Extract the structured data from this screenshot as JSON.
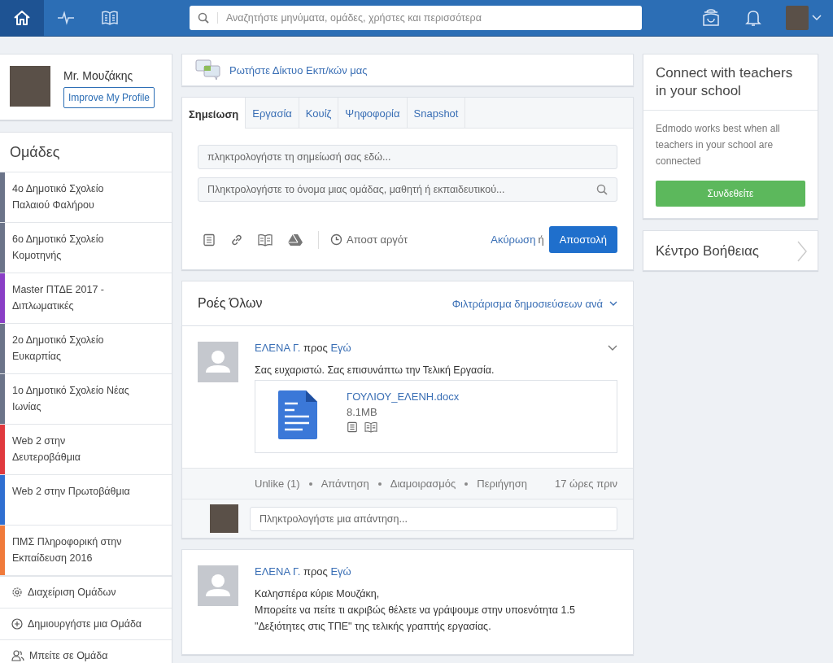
{
  "nav": [
    {
      "kind": "home",
      "selected": true
    },
    {
      "kind": "pulse",
      "selected": false
    },
    {
      "kind": "book",
      "selected": false
    }
  ],
  "search": {
    "placeholder": "Αναζητήστε μηνύματα, ομάδες, χρήστες και περισσότερα"
  },
  "profile": {
    "name": "Mr. Μουζάκης",
    "button": "Improve My Profile"
  },
  "groups": {
    "title": "Ομάδες",
    "items": [
      {
        "name": "4ο Δημοτικό Σχολείο Παλαιού Φαλήρου",
        "color": "#6b7489"
      },
      {
        "name": "6ο Δημοτικό Σχολείο Κομοτηνής",
        "color": "#6b7489"
      },
      {
        "name": "Master ΠΤΔΕ 2017 - Διπλωματικές",
        "color": "#8a3fc6"
      },
      {
        "name": "2ο Δημοτικό Σχολείο Ευκαρπίας",
        "color": "#6b7489"
      },
      {
        "name": "1ο Δημοτικό Σχολείο Νέας Ιωνίας",
        "color": "#6b7489"
      },
      {
        "name": "Web 2 στην Δευτεροβάθμια",
        "color": "#e0393e"
      },
      {
        "name": "Web 2 στην Πρωτοβάθμια",
        "color": "#2f6fd1"
      },
      {
        "name": "ΠΜΣ Πληροφορική στην Εκπαίδευση 2016",
        "color": "#f07a3a"
      }
    ],
    "actions": [
      {
        "kind": "gear",
        "label": "Διαχείριση Ομάδων"
      },
      {
        "kind": "plus",
        "label": "Δημιουργήστε μια Ομάδα"
      },
      {
        "kind": "join",
        "label": "Μπείτε σε Ομάδα"
      }
    ]
  },
  "ask": {
    "label": "Ρωτήστε Δίκτυο Εκπ/κών μας"
  },
  "composer": {
    "tabs": [
      {
        "label": "Σημείωση",
        "selected": true
      },
      {
        "label": "Εργασία",
        "selected": false
      },
      {
        "label": "Κουίζ",
        "selected": false
      },
      {
        "label": "Ψηφοφορία",
        "selected": false
      },
      {
        "label": "Snapshot",
        "selected": false
      }
    ],
    "note_placeholder": "πληκτρολογήστε τη σημείωσή σας εδώ...",
    "recipient_placeholder": "Πληκτρολογήστε το όνομα μιας ομάδας, μαθητή ή εκπαιδευτικού...",
    "schedule": "Αποστ αργότ",
    "cancel": "Ακύρωση",
    "or": "ή",
    "send": "Αποστολή"
  },
  "feed": {
    "title": "Ροές Όλων",
    "filter": "Φιλτράρισμα δημοσιεύσεων ανά",
    "posts": [
      {
        "author": "ΕΛΕΝΑ Γ.",
        "to": "προς",
        "recipient": "Εγώ",
        "body": [
          "Σας ευχαριστώ. Σας επισυνάπτω την Τελική Εργασία."
        ],
        "attachment": {
          "name": "ΓΟΥΛΙΟΥ_ΕΛΕΝΗ.docx",
          "size": "8.1MB"
        },
        "actions": [
          "Unlike (1)",
          "Απάντηση",
          "Διαμοιρασμός",
          "Περιήγηση"
        ],
        "time": "17 ώρες πριν",
        "reply_placeholder": "Πληκτρολογήστε μια απάντηση..."
      },
      {
        "author": "ΕΛΕΝΑ Γ.",
        "to": "προς",
        "recipient": "Εγώ",
        "body": [
          "Καλησπέρα κύριε Μουζάκη,",
          "Μπορείτε να πείτε τι ακριβώς θέλετε να γράψουμε στην υποενότητα 1.5",
          "\"Δεξιότητες στις ΤΠΕ\" της τελικής γραπτής εργασίας."
        ]
      }
    ]
  },
  "connect": {
    "title": "Connect with teachers in your school",
    "text": "Edmodo works best when all teachers in your school are connected",
    "button": "Συνδεθείτε"
  },
  "help": {
    "label": "Κέντρο Βοήθειας"
  }
}
